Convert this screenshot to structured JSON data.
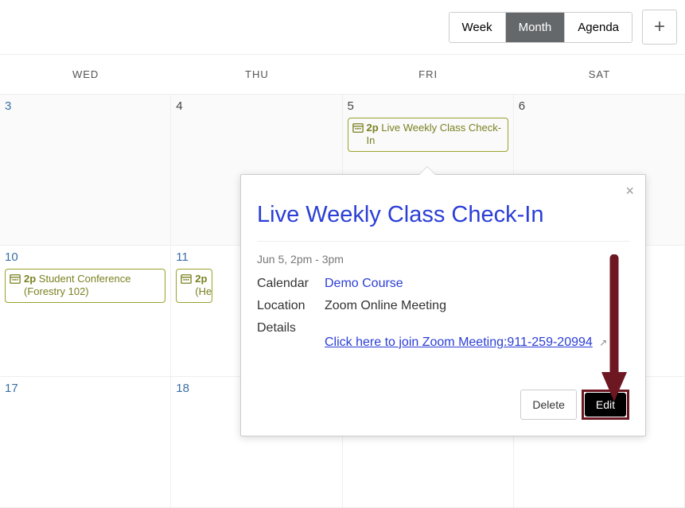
{
  "toolbar": {
    "views": {
      "week": "Week",
      "month": "Month",
      "agenda": "Agenda"
    },
    "add_symbol": "+"
  },
  "headers": [
    "WED",
    "THU",
    "FRI",
    "SAT"
  ],
  "dates": {
    "r1": [
      "3",
      "4",
      "5",
      "6"
    ],
    "r2": [
      "10",
      "11",
      "",
      ""
    ],
    "r3": [
      "17",
      "18",
      "",
      ""
    ]
  },
  "events": {
    "fri5": {
      "time": "2p",
      "title": "Live Weekly Class Check-In"
    },
    "wed10": {
      "time": "2p",
      "title": "Student Conference (Forestry 102)"
    },
    "thu11": {
      "time": "2p",
      "title": "(Heath"
    }
  },
  "popover": {
    "title": "Live Weekly Class Check-In",
    "time_range": "Jun 5, 2pm - 3pm",
    "labels": {
      "calendar": "Calendar",
      "location": "Location",
      "details": "Details"
    },
    "calendar": "Demo Course",
    "location": "Zoom Online Meeting",
    "details_link": "Click here to join Zoom Meeting:911-259-20994",
    "close": "×",
    "delete": "Delete",
    "edit": "Edit"
  }
}
